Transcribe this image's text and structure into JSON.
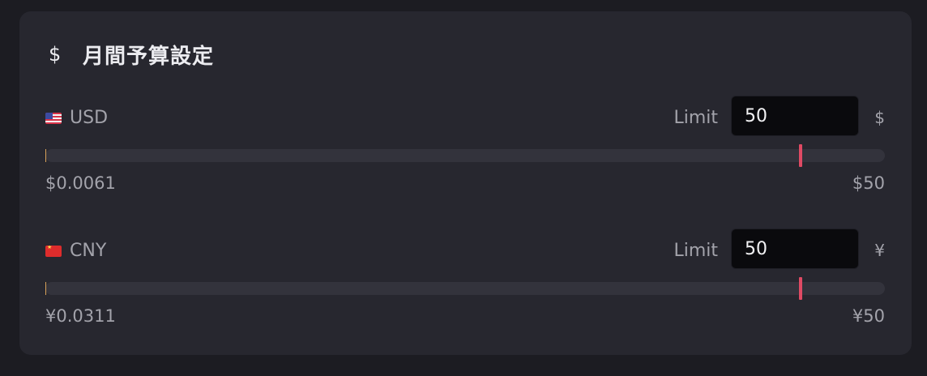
{
  "panel": {
    "icon": "dollar-icon",
    "icon_glyph": "$",
    "title": "月間予算設定"
  },
  "currencies": [
    {
      "flag": "us-flag-icon",
      "code": "USD",
      "limit_label": "Limit",
      "limit_value": "50",
      "unit": "$",
      "used": "$0.0061",
      "max": "$50",
      "used_fraction": 0.000122,
      "threshold_fraction": 0.9,
      "used_color": "#d9a25a",
      "marker_color": "#e04a64"
    },
    {
      "flag": "cn-flag-icon",
      "code": "CNY",
      "limit_label": "Limit",
      "limit_value": "50",
      "unit": "¥",
      "used": "¥0.0311",
      "max": "¥50",
      "used_fraction": 0.000622,
      "threshold_fraction": 0.9,
      "used_color": "#d9a25a",
      "marker_color": "#e04a64"
    }
  ]
}
